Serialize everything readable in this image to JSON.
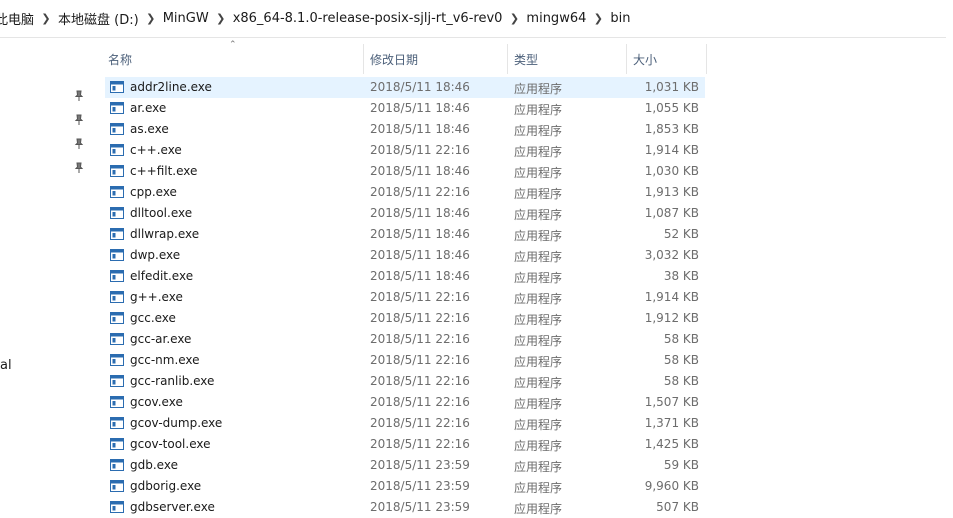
{
  "breadcrumb": [
    "此电脑",
    "本地磁盘 (D:)",
    "MinGW",
    "x86_64-8.1.0-release-posix-sjlj-rt_v6-rev0",
    "mingw64",
    "bin"
  ],
  "nav": {
    "partial_label": "al"
  },
  "columns": {
    "name": "名称",
    "date": "修改日期",
    "type": "类型",
    "size": "大小"
  },
  "files": [
    {
      "name": "addr2line.exe",
      "date": "2018/5/11 18:46",
      "type": "应用程序",
      "size": "1,031 KB"
    },
    {
      "name": "ar.exe",
      "date": "2018/5/11 18:46",
      "type": "应用程序",
      "size": "1,055 KB"
    },
    {
      "name": "as.exe",
      "date": "2018/5/11 18:46",
      "type": "应用程序",
      "size": "1,853 KB"
    },
    {
      "name": "c++.exe",
      "date": "2018/5/11 22:16",
      "type": "应用程序",
      "size": "1,914 KB"
    },
    {
      "name": "c++filt.exe",
      "date": "2018/5/11 18:46",
      "type": "应用程序",
      "size": "1,030 KB"
    },
    {
      "name": "cpp.exe",
      "date": "2018/5/11 22:16",
      "type": "应用程序",
      "size": "1,913 KB"
    },
    {
      "name": "dlltool.exe",
      "date": "2018/5/11 18:46",
      "type": "应用程序",
      "size": "1,087 KB"
    },
    {
      "name": "dllwrap.exe",
      "date": "2018/5/11 18:46",
      "type": "应用程序",
      "size": "52 KB"
    },
    {
      "name": "dwp.exe",
      "date": "2018/5/11 18:46",
      "type": "应用程序",
      "size": "3,032 KB"
    },
    {
      "name": "elfedit.exe",
      "date": "2018/5/11 18:46",
      "type": "应用程序",
      "size": "38 KB"
    },
    {
      "name": "g++.exe",
      "date": "2018/5/11 22:16",
      "type": "应用程序",
      "size": "1,914 KB"
    },
    {
      "name": "gcc.exe",
      "date": "2018/5/11 22:16",
      "type": "应用程序",
      "size": "1,912 KB"
    },
    {
      "name": "gcc-ar.exe",
      "date": "2018/5/11 22:16",
      "type": "应用程序",
      "size": "58 KB"
    },
    {
      "name": "gcc-nm.exe",
      "date": "2018/5/11 22:16",
      "type": "应用程序",
      "size": "58 KB"
    },
    {
      "name": "gcc-ranlib.exe",
      "date": "2018/5/11 22:16",
      "type": "应用程序",
      "size": "58 KB"
    },
    {
      "name": "gcov.exe",
      "date": "2018/5/11 22:16",
      "type": "应用程序",
      "size": "1,507 KB"
    },
    {
      "name": "gcov-dump.exe",
      "date": "2018/5/11 22:16",
      "type": "应用程序",
      "size": "1,371 KB"
    },
    {
      "name": "gcov-tool.exe",
      "date": "2018/5/11 22:16",
      "type": "应用程序",
      "size": "1,425 KB"
    },
    {
      "name": "gdb.exe",
      "date": "2018/5/11 23:59",
      "type": "应用程序",
      "size": "59 KB"
    },
    {
      "name": "gdborig.exe",
      "date": "2018/5/11 23:59",
      "type": "应用程序",
      "size": "9,960 KB"
    },
    {
      "name": "gdbserver.exe",
      "date": "2018/5/11 23:59",
      "type": "应用程序",
      "size": "507 KB"
    }
  ],
  "colors": {
    "selected_row": "#e5f3ff",
    "header_text": "#4c607a",
    "icon_blue": "#2b6cb0"
  }
}
